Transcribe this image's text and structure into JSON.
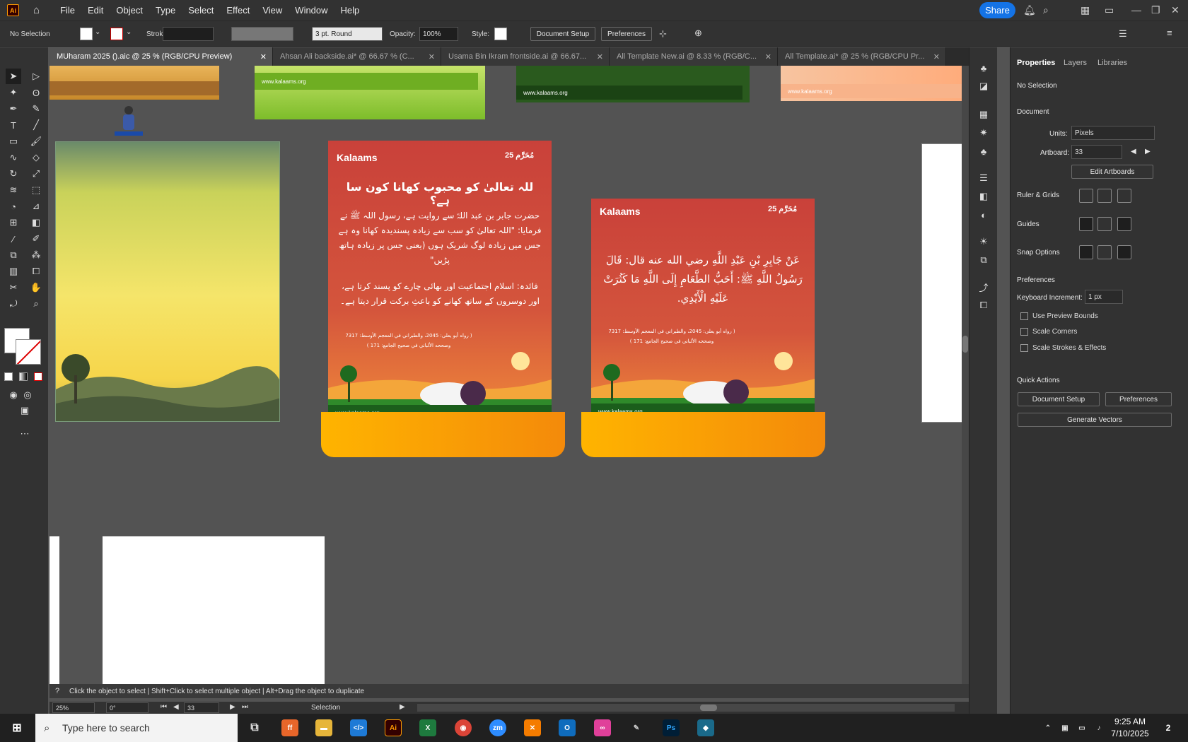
{
  "app": {
    "logo": "Ai"
  },
  "menu": [
    "File",
    "Edit",
    "Object",
    "Type",
    "Select",
    "Effect",
    "View",
    "Window",
    "Help"
  ],
  "share_label": "Share",
  "control": {
    "selection": "No Selection",
    "stroke_label": "Stroke:",
    "brush": "3 pt. Round",
    "opacity_label": "Opacity:",
    "opacity": "100%",
    "style_label": "Style:",
    "doc_setup": "Document Setup",
    "preferences": "Preferences"
  },
  "tabs": [
    {
      "label": "MUharam 2025 ().aic @ 25 % (RGB/CPU Preview)"
    },
    {
      "label": "Ahsan Ali backside.ai* @ 66.67 % (C..."
    },
    {
      "label": "Usama Bin Ikram frontside.ai @ 66.67..."
    },
    {
      "label": "All Template New.ai @ 8.33 % (RGB/C..."
    },
    {
      "label": "All Template.ai* @ 25 % (RGB/CPU Pr..."
    }
  ],
  "panel": {
    "tabs": [
      "Properties",
      "Layers",
      "Libraries"
    ],
    "no_selection": "No Selection",
    "document": "Document",
    "units_label": "Units:",
    "units": "Pixels",
    "artboard_label": "Artboard:",
    "artboard": "33",
    "edit_artboards": "Edit Artboards",
    "ruler_grids": "Ruler & Grids",
    "guides": "Guides",
    "snap": "Snap Options",
    "preferences": "Preferences",
    "kbd_label": "Keyboard Increment:",
    "kbd": "1 px",
    "preview_bounds": "Use Preview Bounds",
    "scale_corners": "Scale Corners",
    "scale_strokes": "Scale Strokes & Effects",
    "quick_actions": "Quick Actions",
    "qa_doc": "Document Setup",
    "qa_pref": "Preferences",
    "qa_gen": "Generate Vectors"
  },
  "status": {
    "hint": "Click the object to select  |  Shift+Click to select multiple object  |  Alt+Drag the object to duplicate",
    "zoom": "25%",
    "rotate": "0°",
    "artboard": "33",
    "tool": "Selection"
  },
  "cards": {
    "brand": "Kalaams",
    "muharram": "مُحَرَّم 25",
    "site": "www.kalaams.org",
    "urdu_title": "للہ تعالیٰ کو محبوب کھانا کون سا ہے؟",
    "urdu_body": "حضرت جابر بن عبد اللہؓ سے روایت ہے، رسول اللہ ﷺ نے فرمایا: \"اللہ تعالیٰ کو سب سے زیادہ پسندیدہ کھانا وہ ہے جس میں زیادہ لوگ شریک ہوں (یعنی جس پر زیادہ ہاتھ پڑیں\"",
    "urdu_note": "فائدہ: اسلام اجتماعیت اور بھائی چارے کو پسند کرتا ہے، اور دوسروں کے ساتھ کھانے کو باعثِ برکت قرار دیتا ہے۔",
    "ref1": "( رواه أبو يعلى: 2045، والطبراني في المعجم الأوسط: 7317",
    "ref2": "وصححه الألباني في صحيح الجامع: 171 )",
    "arabic": "عَنْ جَابِرِ بْنِ عَبْدِ اللَّهِ رضي الله عنه قال: قَالَ رَسُولُ اللَّهِ ﷺ: أَحَبُّ الطَّعَامِ إِلَى اللَّهِ مَا كَثُرَتْ عَلَيْهِ الْأَيْدِي."
  },
  "taskbar": {
    "search": "Type here to search",
    "time": "9:25 AM",
    "date": "7/10/2025",
    "notif": "2"
  }
}
